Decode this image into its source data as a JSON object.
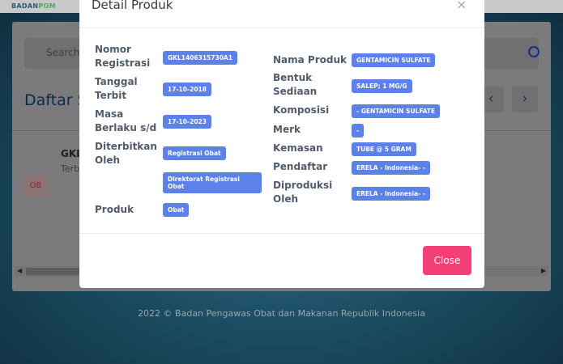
{
  "app": {
    "logo_main": "BADAN",
    "logo_sub": "POM",
    "footer": "2022 ©  Badan Pengawas Obat dan Makanan Republik Indonesia"
  },
  "list_page": {
    "search_placeholder": "Search",
    "title": "Daftar S",
    "prev_icon": "chevron-left-icon",
    "next_icon": "chevron-right-icon",
    "row_code": "GKL",
    "row_sub": "Terb",
    "row_badge": "OB"
  },
  "modal": {
    "title": "Detail Produk",
    "close_x": "×",
    "close_button": "Close",
    "fields_left": [
      {
        "label": "Nomor Registrasi",
        "value": "GKL1406315730A1"
      },
      {
        "label": "Tanggal Terbit",
        "value": "17-10-2018"
      },
      {
        "label": "Masa Berlaku s/d",
        "value": "17-10-2023"
      },
      {
        "label": "Diterbitkan Oleh",
        "value": "Registrasi Obat"
      },
      {
        "label": "",
        "value": "Direktorat Registrasi Obat"
      },
      {
        "label": "Produk",
        "value": "Obat"
      }
    ],
    "fields_right": [
      {
        "label": "Nama Produk",
        "value": "GENTAMICIN SULFATE"
      },
      {
        "label": "Bentuk Sediaan",
        "value": "SALEP; 1 MG/G"
      },
      {
        "label": "Komposisi",
        "value": "- GENTAMICIN SULFATE"
      },
      {
        "label": "Merk",
        "value": "-"
      },
      {
        "label": "Kemasan",
        "value": "TUBE @ 5 GRAM"
      },
      {
        "label": "Pendaftar",
        "value": "ERELA - Indonesia- -"
      },
      {
        "label": "Diproduksi Oleh",
        "value": "ERELA - Indonesia- -"
      }
    ]
  },
  "colors": {
    "badge": "#5c82ea",
    "close_button": "#f53f77",
    "label_text": "#515b6c"
  }
}
